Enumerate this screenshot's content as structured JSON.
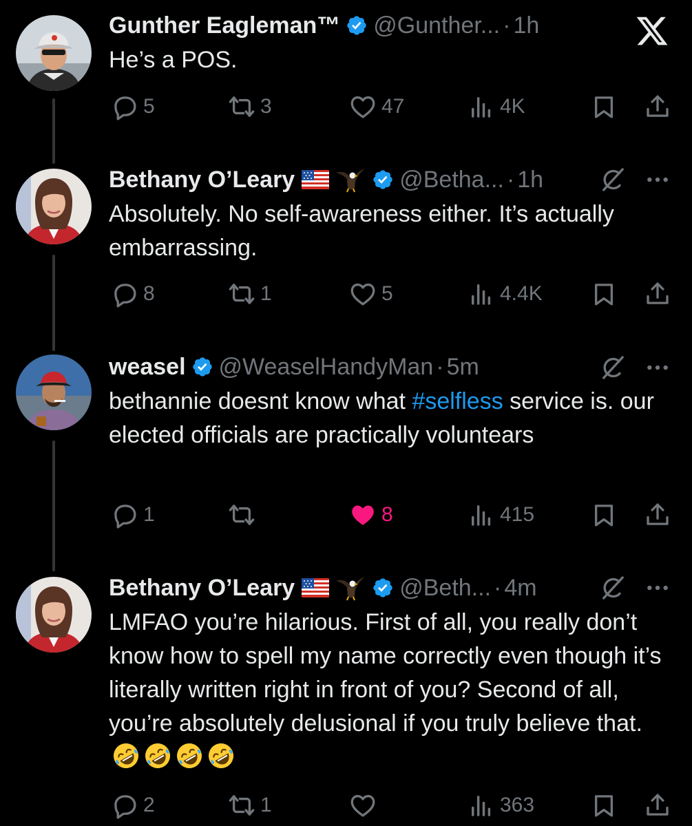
{
  "tweets": [
    {
      "name": "Gunther Eagleman™",
      "handle": "@Gunther...",
      "sep": "·",
      "time": "1h",
      "text": "He’s a POS.",
      "replies": "5",
      "reposts": "3",
      "likes": "47",
      "views": "4K"
    },
    {
      "name": "Bethany O’Leary",
      "handle": "@Betha...",
      "sep": "·",
      "time": "1h",
      "text": "Absolutely. No self-awareness either. It’s actually embarrassing.",
      "replies": "8",
      "reposts": "1",
      "likes": "5",
      "views": "4.4K"
    },
    {
      "name": "weasel",
      "handle": "@WeaselHandyMan",
      "sep": "·",
      "time": "5m",
      "text_before": "bethannie doesnt know what ",
      "hashtag": "#selfless",
      "text_after": " service is. our elected officials are practically voluntears",
      "replies": "1",
      "reposts": "",
      "likes": "8",
      "liked": true,
      "views": "415"
    },
    {
      "name": "Bethany O’Leary",
      "handle": "@Beth...",
      "sep": "·",
      "time": "4m",
      "text": "LMFAO you’re hilarious. First of all, you really don’t know how to spell my name correctly even though it’s literally written right in front of you? Second of all, you’re absolutely delusional if you truly believe that.",
      "replies": "2",
      "reposts": "1",
      "likes": "",
      "views": "363"
    }
  ],
  "icons": {
    "verified": "verified-badge-icon",
    "reply": "reply-icon",
    "repost": "repost-icon",
    "like": "heart-icon",
    "views": "views-icon",
    "bookmark": "bookmark-icon",
    "share": "share-icon",
    "grok": "grok-icon",
    "more": "more-icon",
    "x_logo": "x-logo-icon"
  },
  "colors": {
    "background": "#000000",
    "text": "#e7e9ea",
    "muted": "#71767b",
    "verified": "#1d9bf0",
    "hashtag": "#1d9bf0",
    "liked": "#f91880"
  }
}
